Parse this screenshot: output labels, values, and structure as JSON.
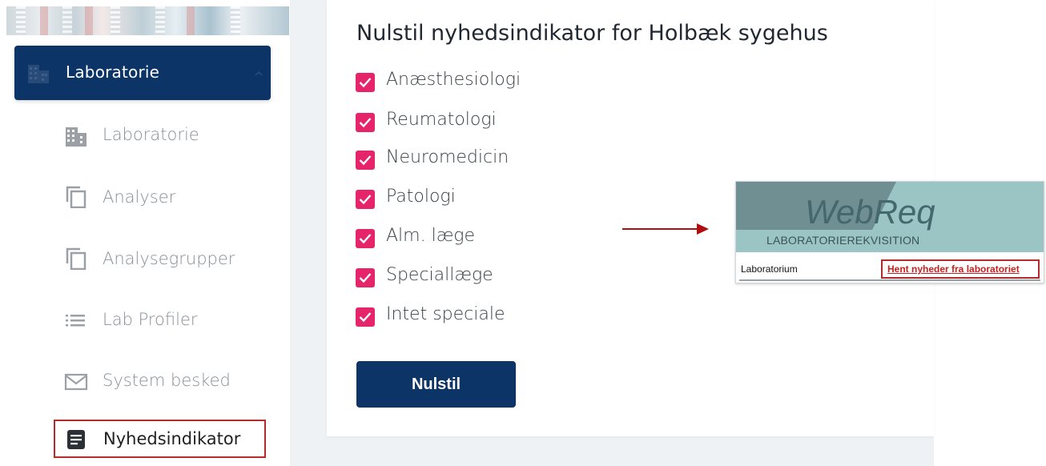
{
  "sidebar": {
    "section_label": "Laboratorie",
    "items": [
      {
        "label": "Laboratorie",
        "icon": "building-icon"
      },
      {
        "label": "Analyser",
        "icon": "copy-icon"
      },
      {
        "label": "Analysegrupper",
        "icon": "copy-icon"
      },
      {
        "label": "Lab Profiler",
        "icon": "list-icon"
      },
      {
        "label": "System besked",
        "icon": "mail-icon"
      }
    ],
    "active_item": {
      "label": "Nyhedsindikator",
      "icon": "document-icon"
    }
  },
  "main": {
    "title": "Nulstil nyhedsindikator for Holbæk sygehus",
    "checkboxes": [
      {
        "label": "Anæsthesiologi",
        "checked": true
      },
      {
        "label": "Reumatologi",
        "checked": true
      },
      {
        "label": "Neuromedicin",
        "checked": true
      },
      {
        "label": "Patologi",
        "checked": true
      },
      {
        "label": "Alm. læge",
        "checked": true
      },
      {
        "label": "Speciallæge",
        "checked": true
      },
      {
        "label": "Intet speciale",
        "checked": true
      }
    ],
    "reset_button": "Nulstil"
  },
  "inset": {
    "brand": "WebReq",
    "subtitle": "LABORATORIEREKVISITION",
    "label": "Laboratorium",
    "link": "Hent nyheder fra laboratoriet"
  },
  "colors": {
    "navy": "#0c3466",
    "checkbox_pink": "#e6246a",
    "highlight_red": "#b52a2a"
  }
}
